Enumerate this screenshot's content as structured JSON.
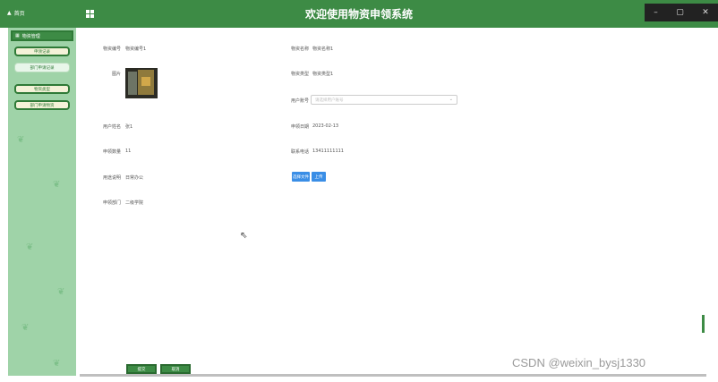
{
  "topbar": {
    "home_label": "首页",
    "title": "欢迎使用物资申领系统",
    "win_min": "–",
    "win_max": "▢",
    "win_close": "✕"
  },
  "sidebar": {
    "menu_head": "物资管理",
    "items": [
      {
        "label": "申领记录"
      },
      {
        "label": "部门申请记录"
      },
      {
        "label": "物资类型"
      },
      {
        "label": "部门申请物资"
      }
    ]
  },
  "form": {
    "labels": {
      "wz_code": "物资编号",
      "wz_name": "物资名称",
      "photo": "图片",
      "wz_type": "物资类型",
      "user_no": "用户账号",
      "user_name": "用户姓名",
      "apply_date": "申领日期",
      "apply_qty": "申领数量",
      "phone": "联系电话",
      "use_note": "用途说明",
      "dept": "申领部门"
    },
    "values": {
      "wz_code": "物资编号1",
      "wz_name": "物资名称1",
      "wz_type": "物资类型1",
      "user_no_placeholder": "请选择用户账号",
      "user_name": "张1",
      "apply_date": "2023-02-13",
      "apply_qty": "11",
      "phone": "13411111111",
      "use_note": "日常办公",
      "dept": "二级学院"
    },
    "select_caret": "⌄",
    "upload_btn": "选择文件",
    "upload_btn2": "上传"
  },
  "actions": {
    "submit": "提交",
    "cancel": "取消"
  },
  "watermark": "CSDN @weixin_bysj1330",
  "cursor": "⇖"
}
